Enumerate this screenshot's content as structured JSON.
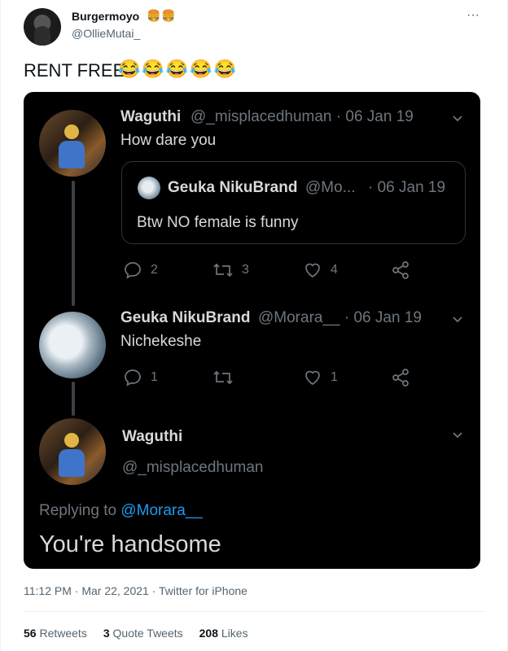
{
  "author": {
    "display_name": "Burgermoyo",
    "name_emoji": "🍔🍔",
    "handle": "@OllieMutai_",
    "more_label": "···"
  },
  "tweet": {
    "text": "RENT FREE",
    "emojis": "😂😂😂😂😂"
  },
  "screenshot": {
    "reply1": {
      "name": "Waguthi",
      "meta": "@_misplacedhuman · 06 Jan 19",
      "text": "How dare you",
      "quote": {
        "name": "Geuka NikuBrand",
        "meta": "@Mo...",
        "date": "· 06 Jan 19",
        "text": "Btw NO female is funny"
      },
      "replies": "2",
      "retweets": "3",
      "likes": "4"
    },
    "reply2": {
      "name": "Geuka NikuBrand",
      "meta": "@Morara__ · 06 Jan 19",
      "text": "Nichekeshe",
      "replies": "1",
      "likes": "1"
    },
    "main": {
      "name": "Waguthi",
      "handle": "@_misplacedhuman",
      "replying_prefix": "Replying to ",
      "replying_to": "@Morara__",
      "text": "You're handsome"
    }
  },
  "footer": {
    "timestamp": "11:12 PM · Mar 22, 2021 · Twitter for iPhone",
    "retweets_count": "56",
    "retweets_label": " Retweets",
    "quotes_count": "3",
    "quotes_label": " Quote Tweets",
    "likes_count": "208",
    "likes_label": " Likes"
  }
}
